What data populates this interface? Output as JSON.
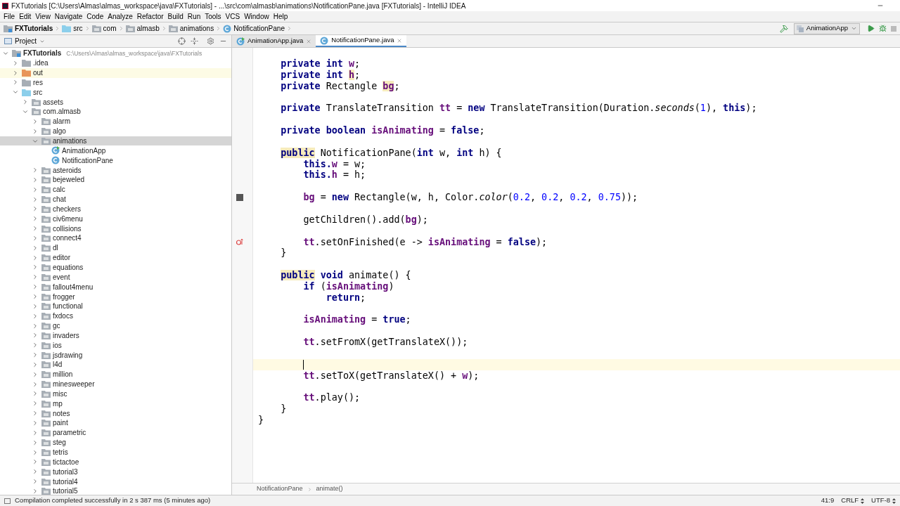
{
  "window": {
    "title": "FXTutorials [C:\\Users\\Almas\\almas_workspace\\java\\FXTutorials] - ...\\src\\com\\almasb\\animations\\NotificationPane.java [FXTutorials] - IntelliJ IDEA"
  },
  "menu": [
    "File",
    "Edit",
    "View",
    "Navigate",
    "Code",
    "Analyze",
    "Refactor",
    "Build",
    "Run",
    "Tools",
    "VCS",
    "Window",
    "Help"
  ],
  "breadcrumbs": [
    {
      "label": "FXTutorials",
      "kind": "project"
    },
    {
      "label": "src",
      "kind": "source"
    },
    {
      "label": "com",
      "kind": "package"
    },
    {
      "label": "almasb",
      "kind": "package"
    },
    {
      "label": "animations",
      "kind": "package"
    },
    {
      "label": "NotificationPane",
      "kind": "class"
    }
  ],
  "run_config": "AnimationApp",
  "project_panel": {
    "title": "Project"
  },
  "tree": [
    {
      "label": "FXTutorials",
      "path": "C:\\Users\\Almas\\almas_workspace\\java\\FXTutorials",
      "kind": "project",
      "expanded": true,
      "selected": false,
      "children": [
        {
          "label": ".idea",
          "kind": "folder",
          "expanded": false,
          "selected": false
        },
        {
          "label": "out",
          "kind": "excluded",
          "expanded": false,
          "selected": false
        },
        {
          "label": "res",
          "kind": "folder",
          "expanded": false,
          "selected": false
        },
        {
          "label": "src",
          "kind": "source",
          "expanded": true,
          "selected": false,
          "children": [
            {
              "label": "assets",
              "kind": "package",
              "expanded": false,
              "selected": false
            },
            {
              "label": "com.almasb",
              "kind": "package",
              "expanded": true,
              "selected": false,
              "children": [
                {
                  "label": "alarm",
                  "kind": "package",
                  "expanded": false,
                  "selected": false
                },
                {
                  "label": "algo",
                  "kind": "package",
                  "expanded": false,
                  "selected": false
                },
                {
                  "label": "animations",
                  "kind": "package",
                  "expanded": true,
                  "selected": true,
                  "children": [
                    {
                      "label": "AnimationApp",
                      "kind": "main_class",
                      "selected": false
                    },
                    {
                      "label": "NotificationPane",
                      "kind": "class",
                      "selected": false
                    }
                  ]
                },
                {
                  "label": "asteroids",
                  "kind": "package",
                  "expanded": false,
                  "selected": false
                },
                {
                  "label": "bejeweled",
                  "kind": "package",
                  "expanded": false,
                  "selected": false
                },
                {
                  "label": "calc",
                  "kind": "package",
                  "expanded": false,
                  "selected": false
                },
                {
                  "label": "chat",
                  "kind": "package",
                  "expanded": false,
                  "selected": false
                },
                {
                  "label": "checkers",
                  "kind": "package",
                  "expanded": false,
                  "selected": false
                },
                {
                  "label": "civ6menu",
                  "kind": "package",
                  "expanded": false,
                  "selected": false
                },
                {
                  "label": "collisions",
                  "kind": "package",
                  "expanded": false,
                  "selected": false
                },
                {
                  "label": "connect4",
                  "kind": "package",
                  "expanded": false,
                  "selected": false
                },
                {
                  "label": "dl",
                  "kind": "package",
                  "expanded": false,
                  "selected": false
                },
                {
                  "label": "editor",
                  "kind": "package",
                  "expanded": false,
                  "selected": false
                },
                {
                  "label": "equations",
                  "kind": "package",
                  "expanded": false,
                  "selected": false
                },
                {
                  "label": "event",
                  "kind": "package",
                  "expanded": false,
                  "selected": false
                },
                {
                  "label": "fallout4menu",
                  "kind": "package",
                  "expanded": false,
                  "selected": false
                },
                {
                  "label": "frogger",
                  "kind": "package",
                  "expanded": false,
                  "selected": false
                },
                {
                  "label": "functional",
                  "kind": "package",
                  "expanded": false,
                  "selected": false
                },
                {
                  "label": "fxdocs",
                  "kind": "package",
                  "expanded": false,
                  "selected": false
                },
                {
                  "label": "gc",
                  "kind": "package",
                  "expanded": false,
                  "selected": false
                },
                {
                  "label": "invaders",
                  "kind": "package",
                  "expanded": false,
                  "selected": false
                },
                {
                  "label": "ios",
                  "kind": "package",
                  "expanded": false,
                  "selected": false
                },
                {
                  "label": "jsdrawing",
                  "kind": "package",
                  "expanded": false,
                  "selected": false
                },
                {
                  "label": "l4d",
                  "kind": "package",
                  "expanded": false,
                  "selected": false
                },
                {
                  "label": "million",
                  "kind": "package",
                  "expanded": false,
                  "selected": false
                },
                {
                  "label": "minesweeper",
                  "kind": "package",
                  "expanded": false,
                  "selected": false
                },
                {
                  "label": "misc",
                  "kind": "package",
                  "expanded": false,
                  "selected": false
                },
                {
                  "label": "mp",
                  "kind": "package",
                  "expanded": false,
                  "selected": false
                },
                {
                  "label": "notes",
                  "kind": "package",
                  "expanded": false,
                  "selected": false
                },
                {
                  "label": "paint",
                  "kind": "package",
                  "expanded": false,
                  "selected": false
                },
                {
                  "label": "parametric",
                  "kind": "package",
                  "expanded": false,
                  "selected": false
                },
                {
                  "label": "steg",
                  "kind": "package",
                  "expanded": false,
                  "selected": false
                },
                {
                  "label": "tetris",
                  "kind": "package",
                  "expanded": false,
                  "selected": false
                },
                {
                  "label": "tictactoe",
                  "kind": "package",
                  "expanded": false,
                  "selected": false
                },
                {
                  "label": "tutorial3",
                  "kind": "package",
                  "expanded": false,
                  "selected": false
                },
                {
                  "label": "tutorial4",
                  "kind": "package",
                  "expanded": false,
                  "selected": false
                },
                {
                  "label": "tutorial5",
                  "kind": "package",
                  "expanded": false,
                  "selected": false
                }
              ]
            }
          ]
        }
      ]
    }
  ],
  "tabs": [
    {
      "label": "AnimationApp.java",
      "kind": "main_class",
      "selected": false
    },
    {
      "label": "NotificationPane.java",
      "kind": "class",
      "selected": true
    }
  ],
  "code": [
    {
      "children": [
        {
          "current": false,
          "tokens": [
            {
              "kind": "keyword",
              "text": "private int "
            },
            {
              "kind": "field",
              "text": "w"
            },
            {
              "kind": "plain",
              "text": ";"
            }
          ]
        },
        {
          "current": false,
          "tokens": [
            {
              "kind": "keyword",
              "text": "private int "
            },
            {
              "kind": "field_usage",
              "text": "h"
            },
            {
              "kind": "plain",
              "text": ";"
            }
          ]
        },
        {
          "current": false,
          "tokens": [
            {
              "kind": "keyword",
              "text": "private"
            },
            {
              "kind": "plain",
              "text": " Rectangle "
            },
            {
              "kind": "field_usage",
              "text": "bg"
            },
            {
              "kind": "plain",
              "text": ";"
            }
          ]
        },
        {
          "current": false
        },
        {
          "current": false,
          "tokens": [
            {
              "kind": "keyword",
              "text": "private"
            },
            {
              "kind": "plain",
              "text": " TranslateTransition "
            },
            {
              "kind": "field",
              "text": "tt"
            },
            {
              "kind": "plain",
              "text": " = "
            },
            {
              "kind": "keyword",
              "text": "new"
            },
            {
              "kind": "plain",
              "text": " TranslateTransition(Duration."
            },
            {
              "kind": "static",
              "text": "seconds"
            },
            {
              "kind": "plain",
              "text": "("
            },
            {
              "kind": "number",
              "text": "1"
            },
            {
              "kind": "plain",
              "text": "), "
            },
            {
              "kind": "keyword",
              "text": "this"
            },
            {
              "kind": "plain",
              "text": ");"
            }
          ]
        },
        {
          "current": false
        },
        {
          "current": false,
          "tokens": [
            {
              "kind": "keyword",
              "text": "private boolean "
            },
            {
              "kind": "field",
              "text": "isAnimating"
            },
            {
              "kind": "plain",
              "text": " = "
            },
            {
              "kind": "keyword",
              "text": "false"
            },
            {
              "kind": "plain",
              "text": ";"
            }
          ]
        },
        {
          "current": false
        },
        {
          "current": false,
          "tokens": [
            {
              "kind": "keyword_usage",
              "text": "public"
            },
            {
              "kind": "plain",
              "text": " NotificationPane("
            },
            {
              "kind": "keyword",
              "text": "int"
            },
            {
              "kind": "plain",
              "text": " w, "
            },
            {
              "kind": "keyword",
              "text": "int"
            },
            {
              "kind": "plain",
              "text": " h) {"
            }
          ],
          "children": [
            {
              "current": false,
              "tokens": [
                {
                  "kind": "keyword",
                  "text": "this."
                },
                {
                  "kind": "field",
                  "text": "w"
                },
                {
                  "kind": "plain",
                  "text": " = w;"
                }
              ]
            },
            {
              "current": false,
              "tokens": [
                {
                  "kind": "keyword",
                  "text": "this."
                },
                {
                  "kind": "field",
                  "text": "h"
                },
                {
                  "kind": "plain",
                  "text": " = h;"
                }
              ]
            },
            {
              "current": false
            },
            {
              "current": false,
              "gutter": {
                "kind": "swatch"
              },
              "tokens": [
                {
                  "kind": "field",
                  "text": "bg"
                },
                {
                  "kind": "plain",
                  "text": " = "
                },
                {
                  "kind": "keyword",
                  "text": "new"
                },
                {
                  "kind": "plain",
                  "text": " Rectangle(w, h, Color."
                },
                {
                  "kind": "static",
                  "text": "color"
                },
                {
                  "kind": "plain",
                  "text": "("
                },
                {
                  "kind": "number",
                  "text": "0.2"
                },
                {
                  "kind": "plain",
                  "text": ", "
                },
                {
                  "kind": "number",
                  "text": "0.2"
                },
                {
                  "kind": "plain",
                  "text": ", "
                },
                {
                  "kind": "number",
                  "text": "0.2"
                },
                {
                  "kind": "plain",
                  "text": ", "
                },
                {
                  "kind": "number",
                  "text": "0.75"
                },
                {
                  "kind": "plain",
                  "text": "));"
                }
              ]
            },
            {
              "current": false
            },
            {
              "current": false,
              "tokens": [
                {
                  "kind": "plain",
                  "text": "getChildren().add("
                },
                {
                  "kind": "field",
                  "text": "bg"
                },
                {
                  "kind": "plain",
                  "text": ");"
                }
              ]
            },
            {
              "current": false
            },
            {
              "current": false,
              "gutter": {
                "kind": "override"
              },
              "tokens": [
                {
                  "kind": "field",
                  "text": "tt"
                },
                {
                  "kind": "plain",
                  "text": ".setOnFinished(e -> "
                },
                {
                  "kind": "field",
                  "text": "isAnimating"
                },
                {
                  "kind": "plain",
                  "text": " = "
                },
                {
                  "kind": "keyword",
                  "text": "false"
                },
                {
                  "kind": "plain",
                  "text": ");"
                }
              ]
            }
          ]
        },
        {
          "current": false,
          "tokens": [
            {
              "kind": "plain",
              "text": "}"
            }
          ]
        },
        {
          "current": false
        },
        {
          "current": false,
          "tokens": [
            {
              "kind": "keyword_usage",
              "text": "public"
            },
            {
              "kind": "keyword",
              "text": " void"
            },
            {
              "kind": "plain",
              "text": " animate() {"
            }
          ],
          "children": [
            {
              "current": false,
              "tokens": [
                {
                  "kind": "keyword",
                  "text": "if"
                },
                {
                  "kind": "plain",
                  "text": " ("
                },
                {
                  "kind": "field",
                  "text": "isAnimating"
                },
                {
                  "kind": "plain",
                  "text": ")"
                }
              ],
              "children": [
                {
                  "current": false,
                  "tokens": [
                    {
                      "kind": "keyword",
                      "text": "return"
                    },
                    {
                      "kind": "plain",
                      "text": ";"
                    }
                  ]
                }
              ]
            },
            {
              "current": false
            },
            {
              "current": false,
              "tokens": [
                {
                  "kind": "field",
                  "text": "isAnimating"
                },
                {
                  "kind": "plain",
                  "text": " = "
                },
                {
                  "kind": "keyword",
                  "text": "true"
                },
                {
                  "kind": "plain",
                  "text": ";"
                }
              ]
            },
            {
              "current": false
            },
            {
              "current": false,
              "tokens": [
                {
                  "kind": "field",
                  "text": "tt"
                },
                {
                  "kind": "plain",
                  "text": ".setFromX(getTranslateX());"
                }
              ]
            },
            {
              "current": false
            },
            {
              "current": true
            },
            {
              "current": false,
              "tokens": [
                {
                  "kind": "field",
                  "text": "tt"
                },
                {
                  "kind": "plain",
                  "text": ".setToX(getTranslateX() + "
                },
                {
                  "kind": "field",
                  "text": "w"
                },
                {
                  "kind": "plain",
                  "text": ");"
                }
              ]
            },
            {
              "current": false
            },
            {
              "current": false,
              "tokens": [
                {
                  "kind": "field",
                  "text": "tt"
                },
                {
                  "kind": "plain",
                  "text": ".play();"
                }
              ]
            }
          ]
        },
        {
          "current": false,
          "tokens": [
            {
              "kind": "plain",
              "text": "}"
            }
          ]
        }
      ]
    },
    {
      "current": false,
      "tokens": [
        {
          "kind": "plain",
          "text": "}"
        }
      ]
    }
  ],
  "editor_breadcrumbs": [
    "NotificationPane",
    "animate()"
  ],
  "status_bar": {
    "message": "Compilation completed successfully in 2 s 387 ms (5 minutes ago)",
    "position": "41:9",
    "line_separator": "CRLF",
    "encoding": "UTF-8"
  }
}
